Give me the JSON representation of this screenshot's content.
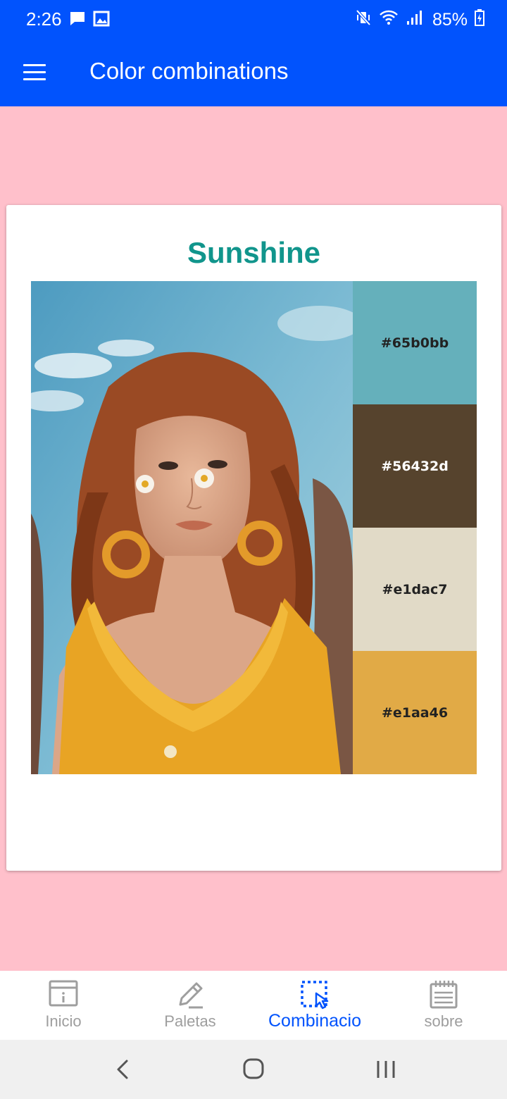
{
  "status_bar": {
    "time": "2:26",
    "battery": "85%",
    "left_icons": [
      "chat-icon",
      "image-icon"
    ],
    "right_icons": [
      "mute-vibrate-icon",
      "wifi-icon",
      "signal-icon",
      "battery-charging-icon"
    ]
  },
  "app_bar": {
    "menu_icon": "hamburger-menu-icon",
    "title": "Color combinations",
    "background": "#0153fd"
  },
  "card": {
    "title": "Sunshine",
    "title_color": "#11958c",
    "photo": "woman with red hair, yellow top, daisies on cheeks, blue sky",
    "swatches": [
      {
        "label": "#65b0bb",
        "color": "#65b0bb",
        "text_color": "#222222"
      },
      {
        "label": "#56432d",
        "color": "#56432d",
        "text_color": "#ffffff"
      },
      {
        "label": "#e1dac7",
        "color": "#e1dac7",
        "text_color": "#222222"
      },
      {
        "label": "#e1aa46",
        "color": "#e1aa46",
        "text_color": "#222222"
      }
    ]
  },
  "page_background": "#ffc0cb",
  "bottom_nav": {
    "items": [
      {
        "label": "Inicio",
        "icon": "browser-window-icon",
        "active": false
      },
      {
        "label": "Paletas",
        "icon": "pencil-icon",
        "active": false
      },
      {
        "label": "Combinacio",
        "icon": "selection-cursor-icon",
        "active": true
      },
      {
        "label": "sobre",
        "icon": "calendar-notepad-icon",
        "active": false
      }
    ],
    "active_color": "#0153fd",
    "inactive_color": "#9e9e9e"
  },
  "system_nav": {
    "buttons": [
      "back-icon",
      "home-icon",
      "recents-icon"
    ]
  }
}
